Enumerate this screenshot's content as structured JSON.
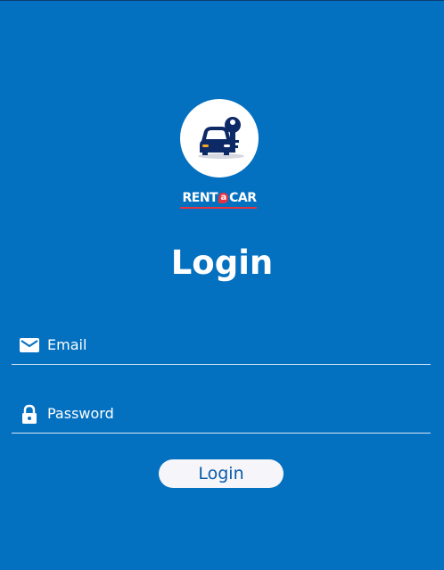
{
  "colors": {
    "background": "#0470c0",
    "field_text": "#ffffff",
    "button_background": "#f6f5fa",
    "button_text": "#0a5aa8",
    "brand_red": "#e63342",
    "logo_navy": "#0e2a66",
    "logo_orange": "#f5a623"
  },
  "logo": {
    "icons": [
      "car-icon",
      "key-icon"
    ],
    "brand_rent": "RENT",
    "brand_a": "a",
    "brand_car": "CAR"
  },
  "page": {
    "title": "Login"
  },
  "form": {
    "email": {
      "icon": "mail-icon",
      "placeholder": "Email",
      "value": ""
    },
    "password": {
      "icon": "lock-icon",
      "placeholder": "Password",
      "value": ""
    },
    "submit_label": "Login"
  }
}
